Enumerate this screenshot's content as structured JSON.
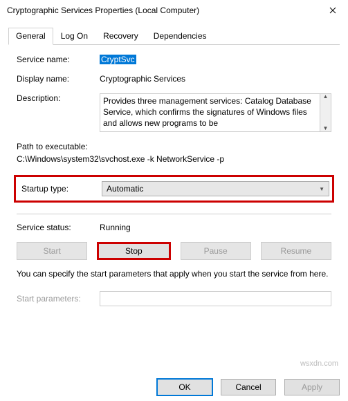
{
  "window": {
    "title": "Cryptographic Services Properties (Local Computer)"
  },
  "tabs": [
    "General",
    "Log On",
    "Recovery",
    "Dependencies"
  ],
  "fields": {
    "service_name_label": "Service name:",
    "service_name_value": "CryptSvc",
    "display_name_label": "Display name:",
    "display_name_value": "Cryptographic Services",
    "description_label": "Description:",
    "description_value": "Provides three management services: Catalog Database Service, which confirms the signatures of Windows files and allows new programs to be",
    "path_label": "Path to executable:",
    "path_value": "C:\\Windows\\system32\\svchost.exe -k NetworkService -p",
    "startup_label": "Startup type:",
    "startup_value": "Automatic",
    "status_label": "Service status:",
    "status_value": "Running",
    "hint": "You can specify the start parameters that apply when you start the service from here.",
    "start_params_label": "Start parameters:",
    "start_params_value": ""
  },
  "buttons": {
    "start": "Start",
    "stop": "Stop",
    "pause": "Pause",
    "resume": "Resume",
    "ok": "OK",
    "cancel": "Cancel",
    "apply": "Apply"
  },
  "watermark": "wsxdn.com"
}
